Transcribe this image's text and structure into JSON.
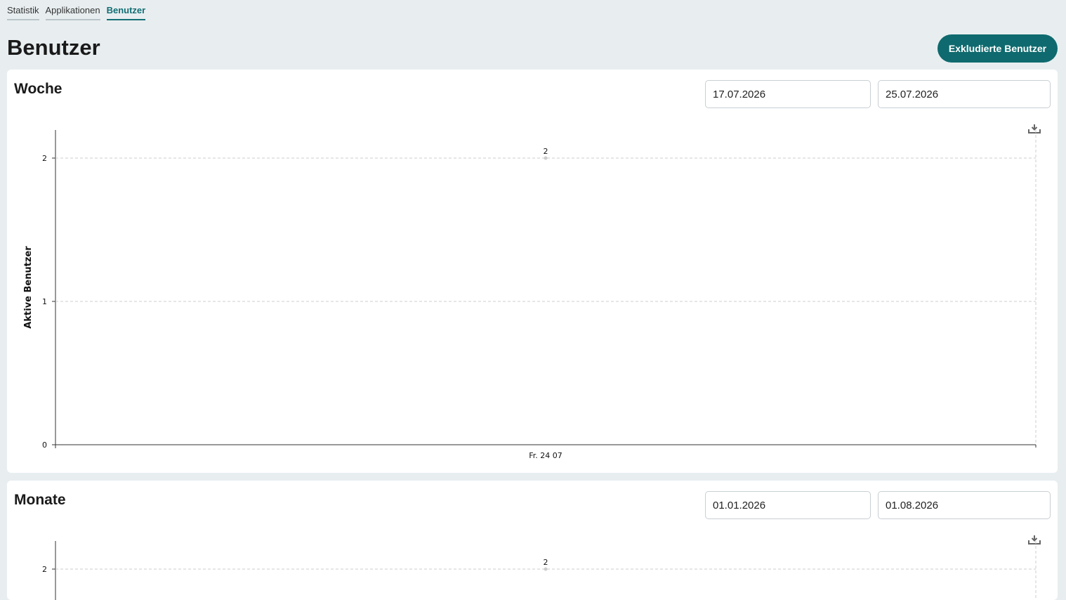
{
  "nav": {
    "tabs": [
      {
        "label": "Statistik",
        "active": false
      },
      {
        "label": "Applikationen",
        "active": false
      },
      {
        "label": "Benutzer",
        "active": true
      }
    ]
  },
  "page": {
    "title": "Benutzer",
    "excluded_button": "Exkludierte Benutzer"
  },
  "colors": {
    "accent": "#0e6a6e",
    "background": "#e8eef0"
  },
  "week": {
    "title": "Woche",
    "date_from": "17.07.2026",
    "date_to": "25.07.2026",
    "download_icon": "download-icon"
  },
  "month": {
    "title": "Monate",
    "date_from": "01.01.2026",
    "date_to": "01.08.2026",
    "download_icon": "download-icon"
  },
  "chart_data": [
    {
      "type": "line",
      "ylabel": "Aktive Benutzer",
      "xlabel": "",
      "ylim": [
        0,
        2
      ],
      "yticks": [
        0,
        1,
        2
      ],
      "grid": true,
      "x": [
        "Fr. 24 07"
      ],
      "series": [
        {
          "values": [
            2
          ]
        }
      ],
      "data_labels": [
        "2"
      ]
    },
    {
      "type": "line",
      "ylim": [
        0,
        2
      ],
      "yticks": [
        2
      ],
      "grid": true,
      "series": [
        {
          "values": [
            2
          ]
        }
      ],
      "data_labels": [
        "2"
      ]
    }
  ]
}
